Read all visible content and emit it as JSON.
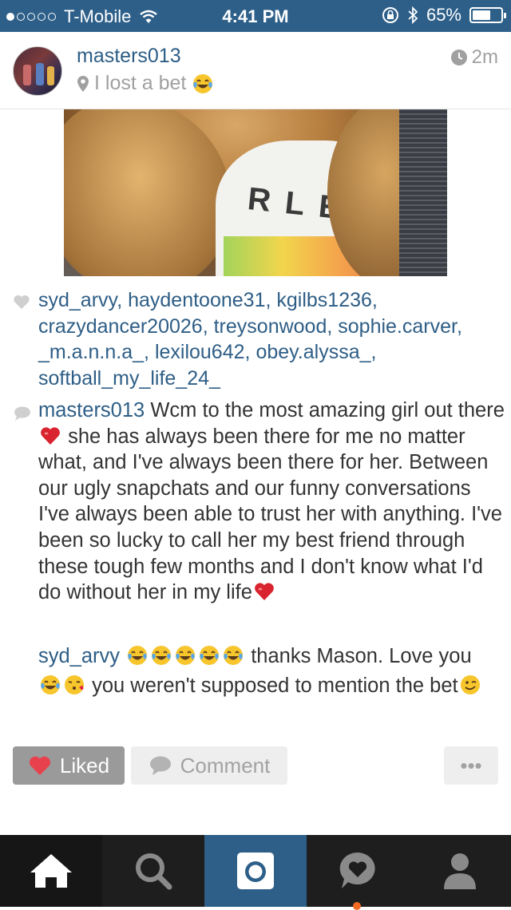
{
  "status_bar": {
    "carrier": "T-Mobile",
    "time": "4:41 PM",
    "battery_percent": "65%",
    "battery_level": 0.65,
    "signal_bars_filled": 1,
    "signal_bars_total": 5
  },
  "post": {
    "username": "masters013",
    "location": "I lost a bet",
    "time_ago": "2m",
    "photo_shirt_text": "RLE"
  },
  "likes": {
    "users": [
      "syd_arvy",
      "haydentoone31",
      "kgilbs1236",
      "crazydancer20026",
      "treysonwood",
      "sophie.carver",
      "_m.a.n.n.a_",
      "lexilou642",
      "obey.alyssa_",
      "softball_my_life_24_"
    ]
  },
  "caption": {
    "username": "masters013",
    "text_part1": "Wcm to the most amazing girl out there",
    "text_part2": " she has always been there for me no matter what, and I've always been there for her. Between our ugly snapchats and our funny conversations I've always been able to trust her with anything. I've been so lucky to call her my best friend through these tough few months and I don't know what I'd do without her in my life"
  },
  "reply": {
    "username": "syd_arvy",
    "text_part1": " thanks Mason. Love you",
    "text_part2": " you weren't supposed to mention the bet"
  },
  "actions": {
    "liked_label": "Liked",
    "comment_label": "Comment",
    "more_label": "•••"
  },
  "tab_bar": {
    "items": [
      "home",
      "explore",
      "camera",
      "activity",
      "profile"
    ],
    "active": "home"
  },
  "colors": {
    "status_bar": "#2d5f89",
    "username": "#2e5e86",
    "liked_heart": "#e8414e",
    "tab_bar": "#1e1e1e",
    "camera_tab": "#2d5f89",
    "notification_dot": "#f26a21"
  },
  "icons": [
    "location-pin-icon",
    "clock-icon",
    "heart-icon",
    "comment-bubble-icon",
    "tears-of-joy-emoji",
    "red-heart-emoji",
    "kiss-emoji",
    "wink-emoji",
    "home-icon",
    "search-icon",
    "camera-icon",
    "activity-heart-icon",
    "profile-icon",
    "wifi-icon",
    "lock-rotation-icon",
    "bluetooth-icon"
  ]
}
